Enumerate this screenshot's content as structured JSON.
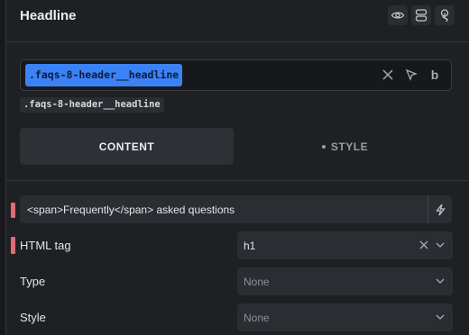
{
  "header": {
    "title": "Headline",
    "icons": [
      "eye-icon",
      "layers-icon",
      "touch-icon"
    ]
  },
  "selector": {
    "chip": ".faqs-8-header__headline",
    "icons": [
      "close-icon",
      "cursor-icon",
      "bold-b-icon"
    ],
    "bold_glyph": "b",
    "class_label": ".faqs-8-header__headline"
  },
  "tabs": {
    "content": "CONTENT",
    "style": "STYLE"
  },
  "fields": {
    "text_value": "<span>Frequently</span> asked questions",
    "html_tag": {
      "label": "HTML tag",
      "value": "h1"
    },
    "type": {
      "label": "Type",
      "value": "None"
    },
    "style": {
      "label": "Style",
      "value": "None"
    }
  },
  "colors": {
    "accent": "#3b82f6",
    "marker": "#e06c75",
    "background": "#1f2024"
  }
}
